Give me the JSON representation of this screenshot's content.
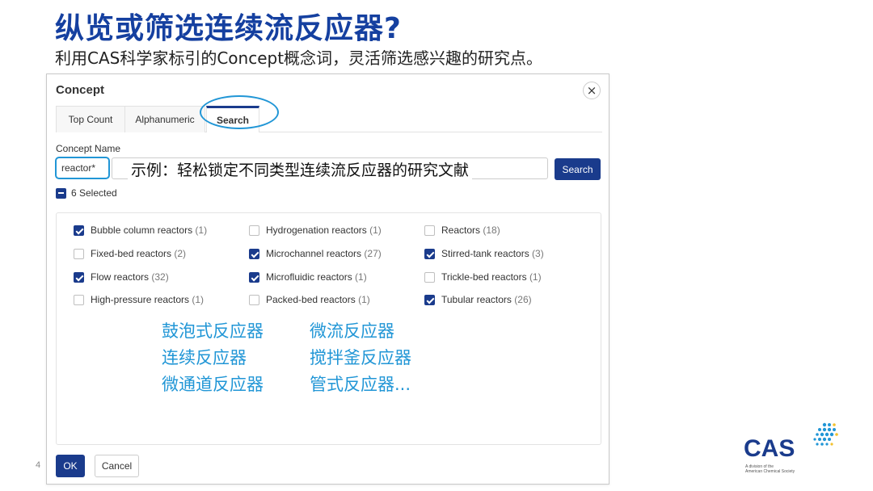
{
  "slide": {
    "title": "纵览或筛选连续流反应器?",
    "subtitle": "利用CAS科学家标引的Concept概念词，灵活筛选感兴趣的研究点。",
    "page_number": "4"
  },
  "dialog": {
    "title": "Concept",
    "close_icon": "×",
    "tabs": [
      {
        "label": "Top Count"
      },
      {
        "label": "Alphanumeric"
      },
      {
        "label": "Search",
        "active": true
      }
    ],
    "field_label": "Concept Name",
    "search_value": "reactor*",
    "overlay_note": "示例：轻松锁定不同类型连续流反应器的研究文献",
    "search_button": "Search",
    "selected_text": "6 Selected",
    "options": [
      {
        "label": "Bubble column reactors",
        "count": "(1)",
        "checked": true
      },
      {
        "label": "Hydrogenation reactors",
        "count": "(1)",
        "checked": false
      },
      {
        "label": "Reactors",
        "count": "(18)",
        "checked": false
      },
      {
        "label": "Fixed-bed reactors",
        "count": "(2)",
        "checked": false
      },
      {
        "label": "Microchannel reactors",
        "count": "(27)",
        "checked": true
      },
      {
        "label": "Stirred-tank reactors",
        "count": "(3)",
        "checked": true
      },
      {
        "label": "Flow reactors",
        "count": "(32)",
        "checked": true
      },
      {
        "label": "Microfluidic reactors",
        "count": "(1)",
        "checked": true
      },
      {
        "label": "Trickle-bed reactors",
        "count": "(1)",
        "checked": false
      },
      {
        "label": "High-pressure reactors",
        "count": "(1)",
        "checked": false
      },
      {
        "label": "Packed-bed reactors",
        "count": "(1)",
        "checked": false
      },
      {
        "label": "Tubular reactors",
        "count": "(26)",
        "checked": true
      }
    ],
    "chinese_annotations": [
      "鼓泡式反应器",
      "微流反应器",
      "连续反应器",
      "搅拌釜反应器",
      "微通道反应器",
      "管式反应器..."
    ],
    "ok_button": "OK",
    "cancel_button": "Cancel"
  },
  "logo": {
    "text": "CAS",
    "tagline_1": "A division of the",
    "tagline_2": "American Chemical Society"
  },
  "colors": {
    "title_blue": "#1540a0",
    "primary": "#1a3b8c",
    "highlight": "#2196d6"
  }
}
